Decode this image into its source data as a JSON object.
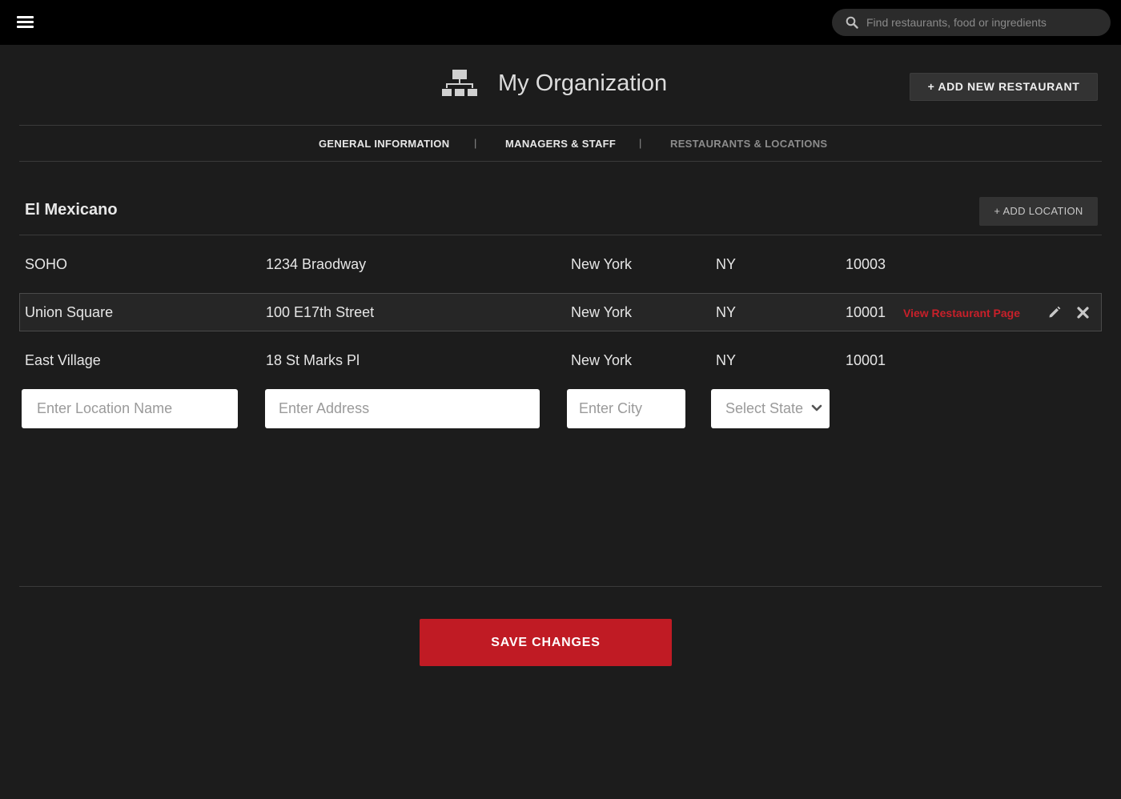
{
  "header": {
    "search_placeholder": "Find restaurants, food or ingredients"
  },
  "page": {
    "title": "My Organization",
    "add_restaurant_label": "+ ADD NEW RESTAURANT"
  },
  "tabs": [
    {
      "label": "GENERAL INFORMATION",
      "active": true
    },
    {
      "label": "MANAGERS & STAFF",
      "active": true
    },
    {
      "label": "RESTAURANTS & LOCATIONS",
      "active": false
    }
  ],
  "tab_separator": "|",
  "restaurant": {
    "name": "El Mexicano",
    "add_location_label": "+ ADD LOCATION",
    "locations": [
      {
        "name": "SOHO",
        "address": "1234 Braodway",
        "city": "New York",
        "state": "NY",
        "zip": "10003"
      },
      {
        "name": "Union Square",
        "address": "100 E17th Street",
        "city": "New York",
        "state": "NY",
        "zip": "10001",
        "link": "View Restaurant Page"
      },
      {
        "name": "East Village",
        "address": "18 St Marks Pl",
        "city": "New York",
        "state": "NY",
        "zip": "10001"
      }
    ]
  },
  "new_location_form": {
    "name_placeholder": "Enter Location Name",
    "address_placeholder": "Enter Address",
    "city_placeholder": "Enter City",
    "state_placeholder": "Select State"
  },
  "footer": {
    "save_label": "SAVE CHANGES"
  },
  "icons": {
    "menu": "hamburger-menu-icon",
    "search": "search-icon",
    "org": "org-chart-icon",
    "edit": "pencil-icon",
    "delete": "close-icon",
    "dropdown": "chevron-down-icon"
  },
  "colors": {
    "background": "#1c1c1c",
    "topbar": "#000000",
    "accent": "#c01b24",
    "link": "#c8202a"
  }
}
